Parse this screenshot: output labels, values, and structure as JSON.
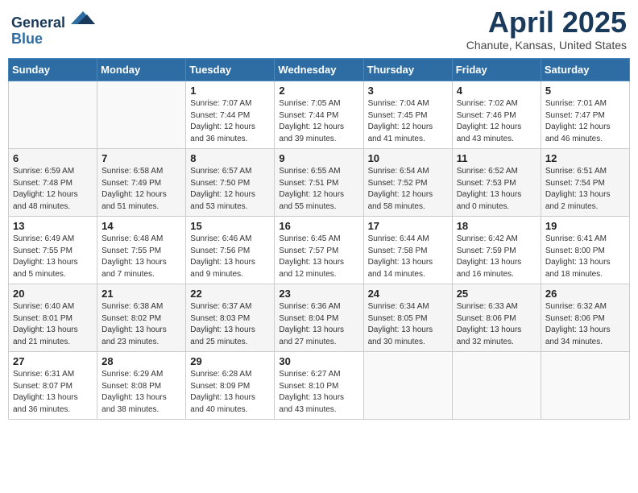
{
  "header": {
    "logo_line1": "General",
    "logo_line2": "Blue",
    "month": "April 2025",
    "location": "Chanute, Kansas, United States"
  },
  "weekdays": [
    "Sunday",
    "Monday",
    "Tuesday",
    "Wednesday",
    "Thursday",
    "Friday",
    "Saturday"
  ],
  "weeks": [
    [
      {
        "day": "",
        "info": ""
      },
      {
        "day": "",
        "info": ""
      },
      {
        "day": "1",
        "info": "Sunrise: 7:07 AM\nSunset: 7:44 PM\nDaylight: 12 hours and 36 minutes."
      },
      {
        "day": "2",
        "info": "Sunrise: 7:05 AM\nSunset: 7:44 PM\nDaylight: 12 hours and 39 minutes."
      },
      {
        "day": "3",
        "info": "Sunrise: 7:04 AM\nSunset: 7:45 PM\nDaylight: 12 hours and 41 minutes."
      },
      {
        "day": "4",
        "info": "Sunrise: 7:02 AM\nSunset: 7:46 PM\nDaylight: 12 hours and 43 minutes."
      },
      {
        "day": "5",
        "info": "Sunrise: 7:01 AM\nSunset: 7:47 PM\nDaylight: 12 hours and 46 minutes."
      }
    ],
    [
      {
        "day": "6",
        "info": "Sunrise: 6:59 AM\nSunset: 7:48 PM\nDaylight: 12 hours and 48 minutes."
      },
      {
        "day": "7",
        "info": "Sunrise: 6:58 AM\nSunset: 7:49 PM\nDaylight: 12 hours and 51 minutes."
      },
      {
        "day": "8",
        "info": "Sunrise: 6:57 AM\nSunset: 7:50 PM\nDaylight: 12 hours and 53 minutes."
      },
      {
        "day": "9",
        "info": "Sunrise: 6:55 AM\nSunset: 7:51 PM\nDaylight: 12 hours and 55 minutes."
      },
      {
        "day": "10",
        "info": "Sunrise: 6:54 AM\nSunset: 7:52 PM\nDaylight: 12 hours and 58 minutes."
      },
      {
        "day": "11",
        "info": "Sunrise: 6:52 AM\nSunset: 7:53 PM\nDaylight: 13 hours and 0 minutes."
      },
      {
        "day": "12",
        "info": "Sunrise: 6:51 AM\nSunset: 7:54 PM\nDaylight: 13 hours and 2 minutes."
      }
    ],
    [
      {
        "day": "13",
        "info": "Sunrise: 6:49 AM\nSunset: 7:55 PM\nDaylight: 13 hours and 5 minutes."
      },
      {
        "day": "14",
        "info": "Sunrise: 6:48 AM\nSunset: 7:55 PM\nDaylight: 13 hours and 7 minutes."
      },
      {
        "day": "15",
        "info": "Sunrise: 6:46 AM\nSunset: 7:56 PM\nDaylight: 13 hours and 9 minutes."
      },
      {
        "day": "16",
        "info": "Sunrise: 6:45 AM\nSunset: 7:57 PM\nDaylight: 13 hours and 12 minutes."
      },
      {
        "day": "17",
        "info": "Sunrise: 6:44 AM\nSunset: 7:58 PM\nDaylight: 13 hours and 14 minutes."
      },
      {
        "day": "18",
        "info": "Sunrise: 6:42 AM\nSunset: 7:59 PM\nDaylight: 13 hours and 16 minutes."
      },
      {
        "day": "19",
        "info": "Sunrise: 6:41 AM\nSunset: 8:00 PM\nDaylight: 13 hours and 18 minutes."
      }
    ],
    [
      {
        "day": "20",
        "info": "Sunrise: 6:40 AM\nSunset: 8:01 PM\nDaylight: 13 hours and 21 minutes."
      },
      {
        "day": "21",
        "info": "Sunrise: 6:38 AM\nSunset: 8:02 PM\nDaylight: 13 hours and 23 minutes."
      },
      {
        "day": "22",
        "info": "Sunrise: 6:37 AM\nSunset: 8:03 PM\nDaylight: 13 hours and 25 minutes."
      },
      {
        "day": "23",
        "info": "Sunrise: 6:36 AM\nSunset: 8:04 PM\nDaylight: 13 hours and 27 minutes."
      },
      {
        "day": "24",
        "info": "Sunrise: 6:34 AM\nSunset: 8:05 PM\nDaylight: 13 hours and 30 minutes."
      },
      {
        "day": "25",
        "info": "Sunrise: 6:33 AM\nSunset: 8:06 PM\nDaylight: 13 hours and 32 minutes."
      },
      {
        "day": "26",
        "info": "Sunrise: 6:32 AM\nSunset: 8:06 PM\nDaylight: 13 hours and 34 minutes."
      }
    ],
    [
      {
        "day": "27",
        "info": "Sunrise: 6:31 AM\nSunset: 8:07 PM\nDaylight: 13 hours and 36 minutes."
      },
      {
        "day": "28",
        "info": "Sunrise: 6:29 AM\nSunset: 8:08 PM\nDaylight: 13 hours and 38 minutes."
      },
      {
        "day": "29",
        "info": "Sunrise: 6:28 AM\nSunset: 8:09 PM\nDaylight: 13 hours and 40 minutes."
      },
      {
        "day": "30",
        "info": "Sunrise: 6:27 AM\nSunset: 8:10 PM\nDaylight: 13 hours and 43 minutes."
      },
      {
        "day": "",
        "info": ""
      },
      {
        "day": "",
        "info": ""
      },
      {
        "day": "",
        "info": ""
      }
    ]
  ]
}
